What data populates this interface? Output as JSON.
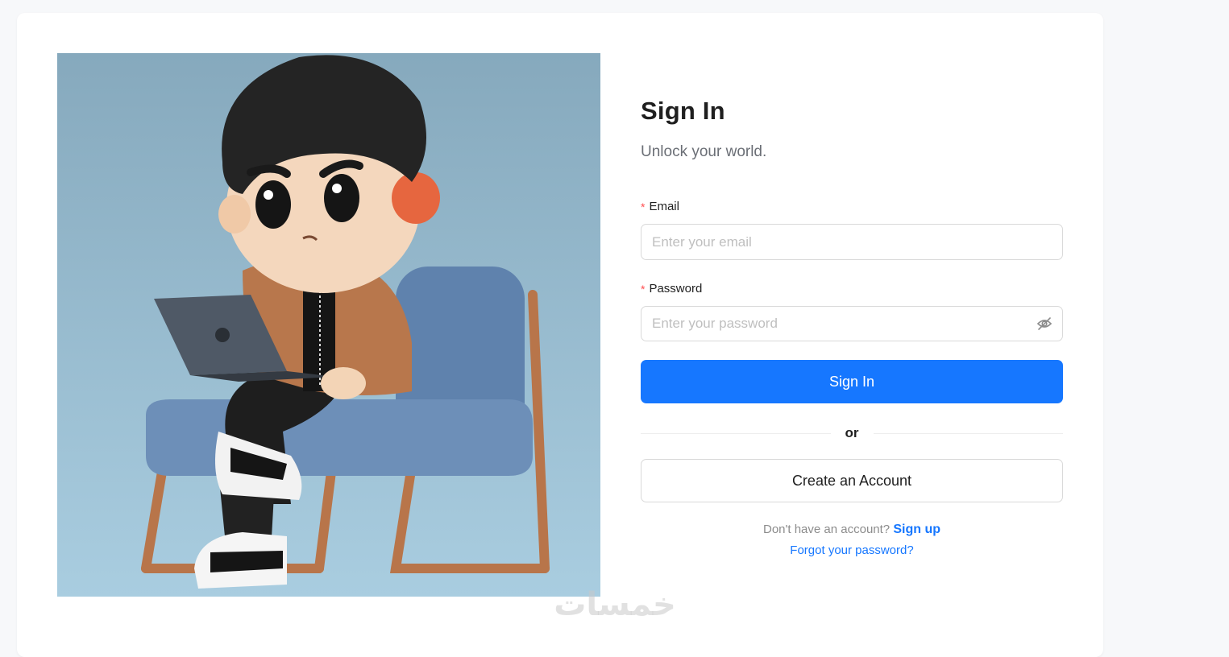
{
  "signin": {
    "title": "Sign In",
    "subtitle": "Unlock your world.",
    "required_mark": "*",
    "email_label": "Email",
    "email_placeholder": "Enter your email",
    "password_label": "Password",
    "password_placeholder": "Enter your password",
    "submit_label": "Sign In",
    "divider_text": "or",
    "create_account_label": "Create an Account",
    "no_account_text": "Don't have an account?",
    "signup_link": "Sign up",
    "forgot_link": "Forgot your password?"
  },
  "watermark": {
    "text": "خمسات"
  },
  "icons": {
    "password_toggle": "eye-slash-icon",
    "illustration": "cartoon-boy-on-chair-with-laptop"
  },
  "colors": {
    "accent": "#1677ff",
    "required": "#ff4d4f",
    "page_bg": "#f7f8fa",
    "illustration_bg": "#8fb3c7"
  }
}
